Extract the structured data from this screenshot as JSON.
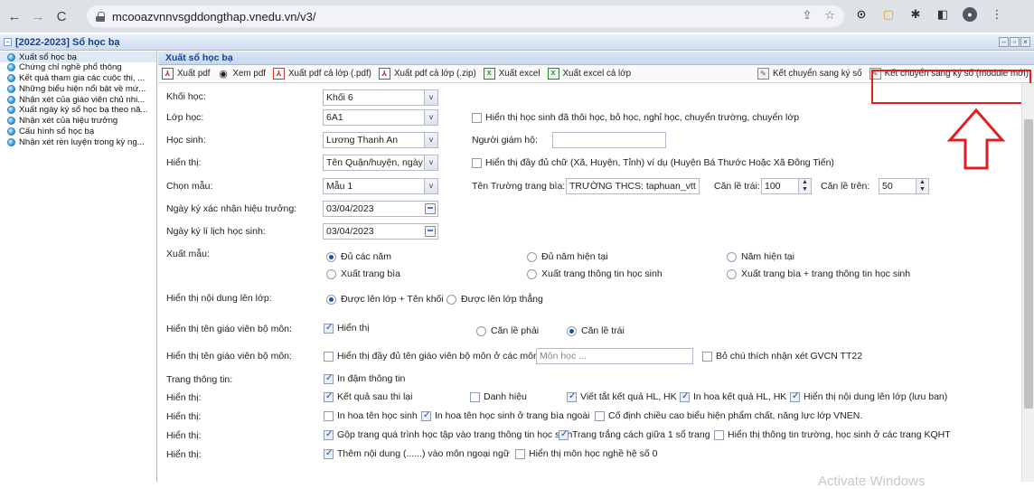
{
  "browser": {
    "url": "mcooazvnnvsgddongthap.vnedu.vn/v3/"
  },
  "window": {
    "title": "[2022-2023] Sổ học bạ"
  },
  "sidebar": {
    "items": [
      {
        "label": "Xuất sổ học bạ"
      },
      {
        "label": "Chứng chỉ nghề phổ thông"
      },
      {
        "label": "Kết quả tham gia các cuộc thi, ..."
      },
      {
        "label": "Những biểu hiện nổi bật về mứ..."
      },
      {
        "label": "Nhận xét của giáo viên chủ nhi..."
      },
      {
        "label": "Xuất ngày ký sổ học bạ theo nă..."
      },
      {
        "label": "Nhận xét của hiệu trưởng"
      },
      {
        "label": "Cấu hình sổ học bạ"
      },
      {
        "label": "Nhận xét rèn luyện trong kỳ ng..."
      }
    ]
  },
  "panel": {
    "title": "Xuất sổ học bạ"
  },
  "toolbar": {
    "xuat_pdf": "Xuất pdf",
    "xem_pdf": "Xem pdf",
    "xuat_pdf_lop": "Xuất pdf cả lớp (.pdf)",
    "xuat_pdf_zip": "Xuất pdf cả lớp (.zip)",
    "xuat_excel": "Xuất excel",
    "xuat_excel_lop": "Xuất excel cả lớp",
    "ket_chuyen": "Kết chuyển sang ký số",
    "ket_chuyen_moi": "Kết chuyển sang ký số (module mới)"
  },
  "form": {
    "khoi_label": "Khối học:",
    "khoi_value": "Khối 6",
    "lop_label": "Lớp học:",
    "lop_value": "6A1",
    "show_left": "Hiển thị học sinh đã thôi học, bỏ học, nghỉ học, chuyển trường, chuyển lớp",
    "hocsinh_label": "Học sinh:",
    "hocsinh_value": "Lương Thanh An",
    "giamho_label": "Người giám hộ:",
    "giamho_value": "",
    "hienthi_label": "Hiển thị:",
    "hienthi_value": "Tên Quận/huyện, ngày",
    "full_name_cb": "Hiển thị đầy đủ chữ (Xã, Huyện, Tỉnh) ví dụ (Huyện Bá Thước Hoặc Xã Đông Tiến)",
    "mau_label": "Chọn mẫu:",
    "mau_value": "Mẫu 1",
    "tentruong_label": "Tên Trường trang bìa:",
    "tentruong_value": "TRƯỜNG THCS: taphuan_vtt",
    "canletrai_label": "Căn lề trái:",
    "canletrai_value": "100",
    "canletren_label": "Căn lề trên:",
    "canletren_value": "50",
    "ngayky_label": "Ngày ký xác nhận hiệu trưởng:",
    "ngayky_value": "03/04/2023",
    "ngaylich_label": "Ngày ký lí lịch học sinh:",
    "ngaylich_value": "03/04/2023",
    "xuatmau_label": "Xuất mẫu:",
    "r_du_cac_nam": "Đủ các năm",
    "r_du_nam_ht": "Đủ năm hiện tại",
    "r_nam_ht": "Năm hiện tại",
    "r_trang_bia": "Xuất trang bìa",
    "r_trang_tt": "Xuất trang thông tin học sinh",
    "r_bia_tt": "Xuất trang bìa + trang thông tin học sinh",
    "lenlop_label": "Hiển thị nội dung lên lớp:",
    "r_lenlop_khoi": "Được lên lớp + Tên khối",
    "r_lenlop_thang": "Được lên lớp thẳng",
    "tengv_label": "Hiển thị tên giáo viên bộ môn:",
    "cb_hienthi": "Hiển thị",
    "r_canlephai": "Căn lề phải",
    "r_canletrai": "Căn lề trái",
    "tengv2_label": "Hiển thị tên giáo viên bộ môn:",
    "cb_full_gv": "Hiển thị đầy đủ tên giáo viên bộ môn ở các môn",
    "monhoc_ph": "Môn học ...",
    "cb_bo_chu_thich": "Bỏ chú thích nhận xét GVCN TT22",
    "trangtt_label": "Trang thông tin:",
    "cb_in_dam": "In đậm thông tin",
    "hienthi2_label": "Hiển thị:",
    "cb_kq_thi_lai": "Kết quả sau thi lại",
    "cb_danh_hieu": "Danh hiệu",
    "cb_viet_tat": "Viết tắt kết quả HL, HK",
    "cb_in_hoa_kq": "In hoa kết quả HL, HK",
    "cb_nd_lenlop": "Hiển thị nội dung lên lớp (lưu ban)",
    "hienthi3_label": "Hiển thị:",
    "cb_in_hoa_ten": "In hoa tên học sinh",
    "cb_in_hoa_bia": "In hoa tên học sinh ở trang bìa ngoài",
    "cb_co_dinh": "Cố định chiều cao biểu hiện phẩm chất, năng lực lớp VNEN.",
    "hienthi4_label": "Hiển thị:",
    "cb_gop_trang": "Gộp trang quá trình học tập vào trang thông tin học sinh",
    "cb_trang_trang": "Trang trắng cách giữa 1 sổ trang",
    "cb_tt_truong": "Hiển thị thông tin trường, học sinh ở các trang KQHT",
    "hienthi5_label": "Hiển thị:",
    "cb_them_nd": "Thêm nội dung (......) vào môn ngoại ngữ",
    "cb_mon_nghe": "Hiển thị môn học nghề hệ số 0"
  },
  "watermark": "Activate Windows",
  "colors": {
    "annotation_red": "#e02020",
    "header_blue": "#15428b"
  }
}
